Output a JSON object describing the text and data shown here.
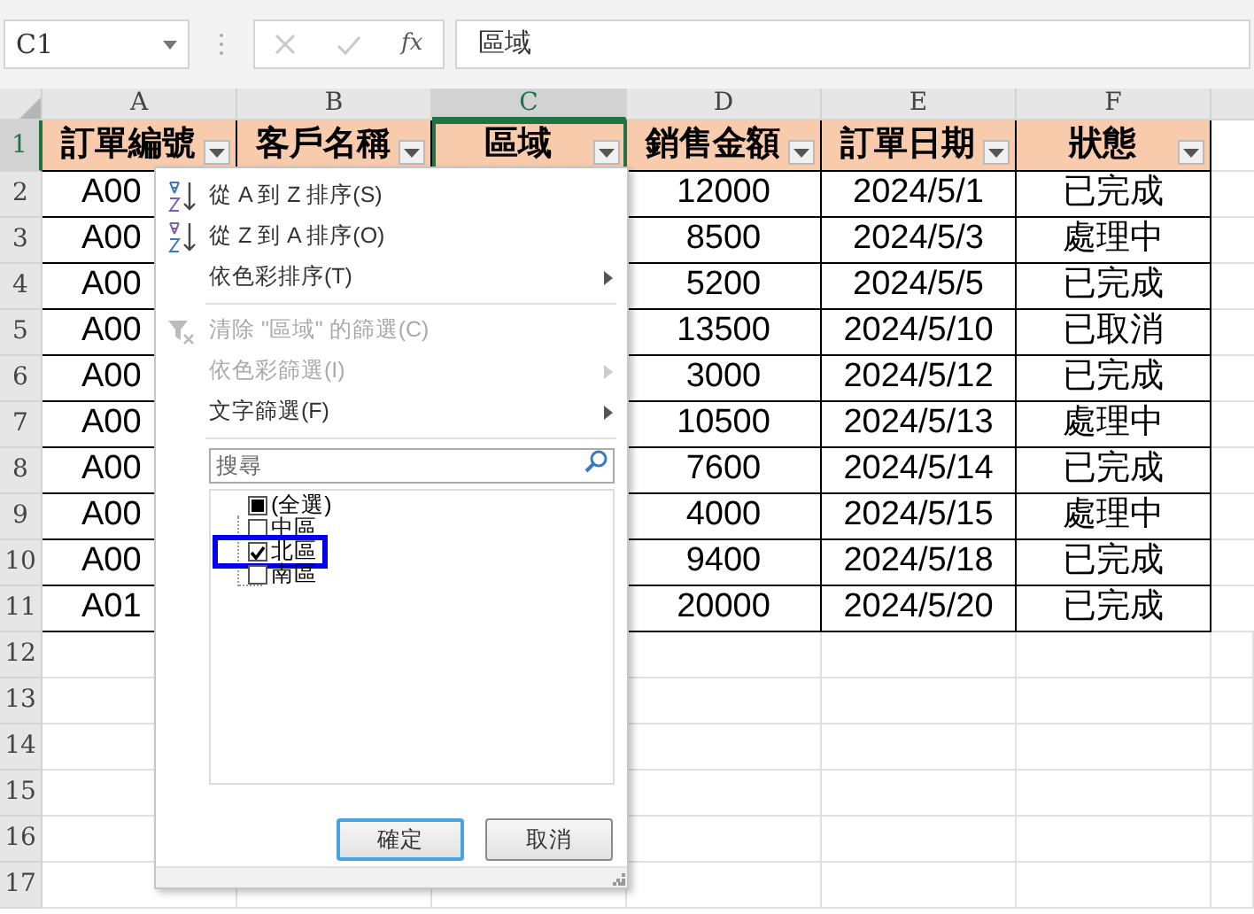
{
  "formula_bar": {
    "name_box": "C1",
    "fx": "fx",
    "formula": "區域"
  },
  "columns": [
    {
      "letter": "A",
      "selected": false
    },
    {
      "letter": "B",
      "selected": false
    },
    {
      "letter": "C",
      "selected": true
    },
    {
      "letter": "D",
      "selected": false
    },
    {
      "letter": "E",
      "selected": false
    },
    {
      "letter": "F",
      "selected": false
    }
  ],
  "row_numbers": [
    {
      "label": "1",
      "selected": true
    },
    {
      "label": "2",
      "selected": false
    },
    {
      "label": "3",
      "selected": false
    },
    {
      "label": "4",
      "selected": false
    },
    {
      "label": "5",
      "selected": false
    },
    {
      "label": "6",
      "selected": false
    },
    {
      "label": "7",
      "selected": false
    },
    {
      "label": "8",
      "selected": false
    },
    {
      "label": "9",
      "selected": false
    },
    {
      "label": "10",
      "selected": false
    },
    {
      "label": "11",
      "selected": false
    },
    {
      "label": "12",
      "selected": false
    },
    {
      "label": "13",
      "selected": false
    },
    {
      "label": "14",
      "selected": false
    },
    {
      "label": "15",
      "selected": false
    },
    {
      "label": "16",
      "selected": false
    },
    {
      "label": "17",
      "selected": false
    }
  ],
  "header_cells": [
    {
      "text": "訂單編號",
      "active": false
    },
    {
      "text": "客戶名稱",
      "active": false
    },
    {
      "text": "區域",
      "active": true
    },
    {
      "text": "銷售金額",
      "active": false
    },
    {
      "text": "訂單日期",
      "active": false
    },
    {
      "text": "狀態",
      "active": false
    }
  ],
  "data_rows": [
    {
      "order_id": "A00",
      "amount": "12000",
      "date": "2024/5/1",
      "status": "已完成"
    },
    {
      "order_id": "A00",
      "amount": "8500",
      "date": "2024/5/3",
      "status": "處理中"
    },
    {
      "order_id": "A00",
      "amount": "5200",
      "date": "2024/5/5",
      "status": "已完成"
    },
    {
      "order_id": "A00",
      "amount": "13500",
      "date": "2024/5/10",
      "status": "已取消"
    },
    {
      "order_id": "A00",
      "amount": "3000",
      "date": "2024/5/12",
      "status": "已完成"
    },
    {
      "order_id": "A00",
      "amount": "10500",
      "date": "2024/5/13",
      "status": "處理中"
    },
    {
      "order_id": "A00",
      "amount": "7600",
      "date": "2024/5/14",
      "status": "已完成"
    },
    {
      "order_id": "A00",
      "amount": "4000",
      "date": "2024/5/15",
      "status": "處理中"
    },
    {
      "order_id": "A00",
      "amount": "9400",
      "date": "2024/5/18",
      "status": "已完成"
    },
    {
      "order_id": "A01",
      "amount": "20000",
      "date": "2024/5/20",
      "status": "已完成"
    }
  ],
  "filter_menu": {
    "items": [
      {
        "kind": "sort_az",
        "label": "從 A 到 Z 排序(S)",
        "disabled": false,
        "submenu": false
      },
      {
        "kind": "sort_za",
        "label": "從 Z 到 A 排序(O)",
        "disabled": false,
        "submenu": false
      },
      {
        "kind": "plain",
        "label": "依色彩排序(T)",
        "disabled": false,
        "submenu": true
      },
      {
        "kind": "separator"
      },
      {
        "kind": "clear_filter",
        "label": "清除 \"區域\" 的篩選(C)",
        "disabled": true,
        "submenu": false
      },
      {
        "kind": "plain",
        "label": "依色彩篩選(I)",
        "disabled": true,
        "submenu": true
      },
      {
        "kind": "plain",
        "label": "文字篩選(F)",
        "disabled": false,
        "submenu": true
      },
      {
        "kind": "separator"
      }
    ],
    "search": {
      "placeholder": "搜尋"
    },
    "values": [
      {
        "label": "(全選)",
        "checked": false,
        "partial": true,
        "highlighted": false
      },
      {
        "label": "中區",
        "checked": false,
        "partial": false,
        "highlighted": false
      },
      {
        "label": "北區",
        "checked": true,
        "partial": false,
        "highlighted": true
      },
      {
        "label": "南區",
        "checked": false,
        "partial": false,
        "highlighted": false
      }
    ],
    "buttons": [
      {
        "label": "確定",
        "focused": true
      },
      {
        "label": "取消",
        "focused": false
      }
    ]
  }
}
